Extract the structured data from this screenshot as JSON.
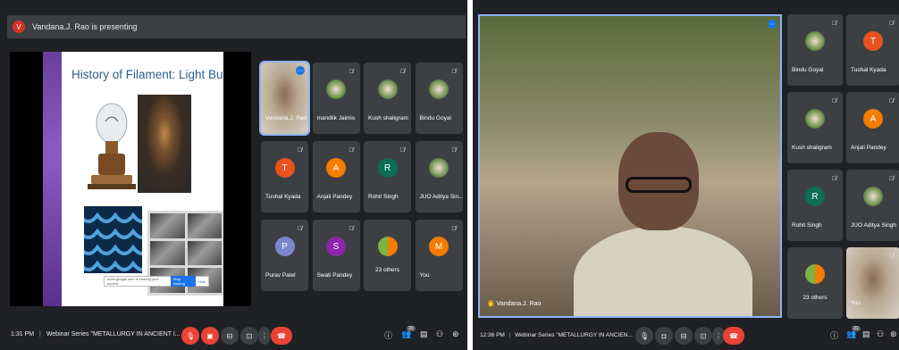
{
  "left": {
    "banner": {
      "initial": "V",
      "text": "Vandana.J. Rao is presenting"
    },
    "slide": {
      "title": "History of Filament: Light Bulb",
      "share_text": "meet.google.com is sharing your screen.",
      "stop_label": "Stop sharing",
      "hide_label": "Hide"
    },
    "tiles": [
      {
        "name": "Vandana.J. Rao",
        "kind": "video",
        "active": true
      },
      {
        "name": "mandlik Jaimis",
        "kind": "photo"
      },
      {
        "name": "Kush shaligram",
        "kind": "photo"
      },
      {
        "name": "Bindu Goyal",
        "kind": "photo"
      },
      {
        "name": "Tushal Kyada",
        "kind": "initial",
        "initial": "T",
        "color": "#e8521f"
      },
      {
        "name": "Anjali Pandey",
        "kind": "initial",
        "initial": "A",
        "color": "#f57c00"
      },
      {
        "name": "Rohit Singh",
        "kind": "initial",
        "initial": "R",
        "color": "#0b6e55"
      },
      {
        "name": "JUO Aditya Sin...",
        "kind": "photo"
      },
      {
        "name": "Purav Patel",
        "kind": "initial",
        "initial": "P",
        "color": "#7986cb"
      },
      {
        "name": "Swati Pandey",
        "kind": "initial",
        "initial": "S",
        "color": "#8e24aa"
      },
      {
        "name": "23 others",
        "kind": "others"
      },
      {
        "name": "You",
        "kind": "initial",
        "initial": "M",
        "color": "#f57c00"
      }
    ],
    "bar": {
      "time": "1:31 PM",
      "separator": "|",
      "title": "Webinar Series \"METALLURGY IN ANCIENT I...",
      "participants_count": "30"
    }
  },
  "right": {
    "main_name": "Vandana.J. Rao",
    "tiles": [
      {
        "name": "Bindu Goyal",
        "kind": "photo"
      },
      {
        "name": "Tushal Kyada",
        "kind": "initial",
        "initial": "T",
        "color": "#e8521f"
      },
      {
        "name": "Kush shaligram",
        "kind": "photo"
      },
      {
        "name": "Anjali Pandey",
        "kind": "initial",
        "initial": "A",
        "color": "#f57c00"
      },
      {
        "name": "Rohit Singh",
        "kind": "initial",
        "initial": "R",
        "color": "#0b6e55"
      },
      {
        "name": "JUO Aditya Singh",
        "kind": "photo"
      },
      {
        "name": "23 others",
        "kind": "others"
      },
      {
        "name": "You",
        "kind": "video"
      }
    ],
    "bar": {
      "time": "12:36 PM",
      "separator": "|",
      "title": "Webinar Series \"METALLURGY IN ANCIEN...",
      "participants_count": "31"
    }
  },
  "icons": {
    "mic": "mic-icon",
    "mic_off": "mic-off-icon",
    "cam_off": "camera-off-icon",
    "captions": "captions-icon",
    "present": "present-icon",
    "more": "more-vert-icon",
    "leave": "leave-call-icon",
    "info": "info-icon",
    "people": "people-icon",
    "chat": "chat-icon",
    "activities": "activities-icon",
    "lock": "host-controls-icon"
  }
}
